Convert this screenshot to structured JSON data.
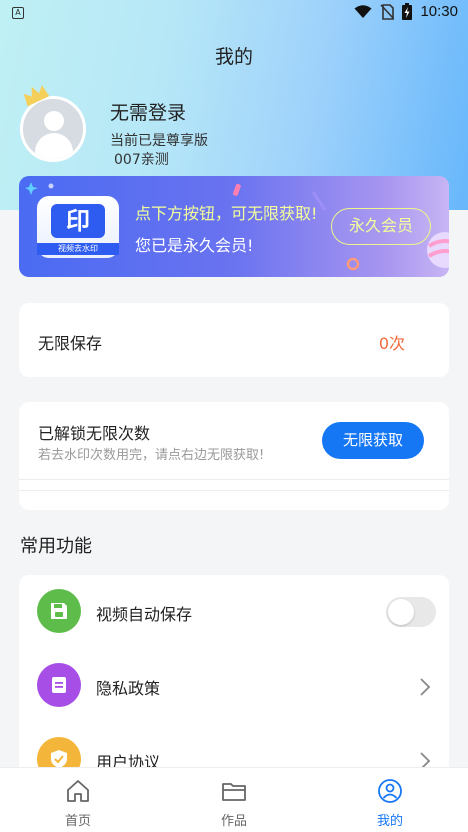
{
  "status_bar": {
    "time": "10:30"
  },
  "page": {
    "title": "我的"
  },
  "user": {
    "name": "无需登录",
    "level": "当前已是尊享版",
    "tag": "007亲测"
  },
  "banner": {
    "logo_text": "印",
    "logo_caption": "视频去水印",
    "line1": "点下方按钮，可无限获取!",
    "line2": "您已是永久会员!",
    "button": "永久会员"
  },
  "save_card": {
    "label": "无限保存",
    "count": "0次"
  },
  "unlock_card": {
    "title": "已解锁无限次数",
    "subtitle": "若去水印次数用完，请点右边无限获取!",
    "button": "无限获取"
  },
  "section": {
    "title": "常用功能"
  },
  "functions": [
    {
      "label": "视频自动保存",
      "icon": "save-icon",
      "color": "#5ebd4a",
      "control": "toggle",
      "toggle_on": false
    },
    {
      "label": "隐私政策",
      "icon": "document-icon",
      "color": "#a64ee6",
      "control": "chevron"
    },
    {
      "label": "用户协议",
      "icon": "shield-check-icon",
      "color": "#f4b63a",
      "control": "chevron"
    }
  ],
  "tabbar": {
    "items": [
      {
        "label": "首页",
        "icon": "home-icon",
        "active": false
      },
      {
        "label": "作品",
        "icon": "folder-icon",
        "active": false
      },
      {
        "label": "我的",
        "icon": "user-circle-icon",
        "active": true
      }
    ],
    "active_color": "#1677f5"
  },
  "colors": {
    "accent": "#1677f5",
    "count": "#ef6a3a",
    "banner_highlight": "#f4ff9a"
  }
}
